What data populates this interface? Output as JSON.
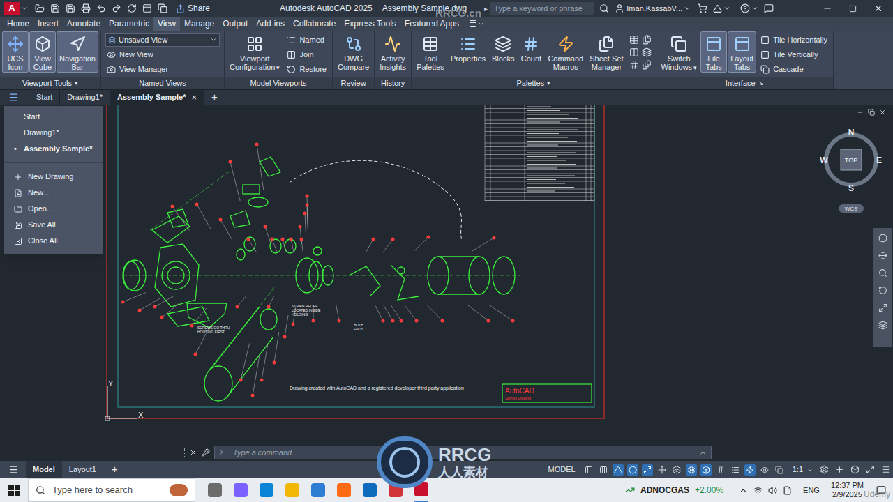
{
  "titlebar": {
    "logo": "A",
    "share": "Share",
    "app": "Autodesk AutoCAD 2025",
    "document": "Assembly Sample.dwg",
    "search_arrow": "▸",
    "search_placeholder": "Type a keyword or phrase",
    "user": "Iman.KassabV..."
  },
  "ribbon_tabs": [
    {
      "label": "Home",
      "selected": false
    },
    {
      "label": "Insert",
      "selected": false
    },
    {
      "label": "Annotate",
      "selected": false
    },
    {
      "label": "Parametric",
      "selected": false
    },
    {
      "label": "View",
      "selected": true
    },
    {
      "label": "Manage",
      "selected": false
    },
    {
      "label": "Output",
      "selected": false
    },
    {
      "label": "Add-ins",
      "selected": false
    },
    {
      "label": "Collaborate",
      "selected": false
    },
    {
      "label": "Express Tools",
      "selected": false
    },
    {
      "label": "Featured Apps",
      "selected": false
    }
  ],
  "ribbon_panels": [
    {
      "title": "Viewport Tools",
      "title_arrow": "▾",
      "large": [
        {
          "lines": [
            "UCS",
            "Icon"
          ],
          "selected": true
        },
        {
          "lines": [
            "View",
            "Cube"
          ],
          "selected": true
        },
        {
          "lines": [
            "Navigation",
            "Bar"
          ],
          "selected": true
        }
      ]
    },
    {
      "title": "Named Views",
      "dropdown": {
        "value": "Unsaved View"
      },
      "small": [
        {
          "label": "New View"
        },
        {
          "label": "View Manager"
        }
      ]
    },
    {
      "title": "Model Viewports",
      "large": [
        {
          "lines": [
            "Viewport",
            "Configuration"
          ],
          "selected": false,
          "arrow": "▾"
        }
      ],
      "small": [
        {
          "label": "Named"
        },
        {
          "label": "Join"
        },
        {
          "label": "Restore"
        }
      ]
    },
    {
      "title": "Review",
      "large": [
        {
          "lines": [
            "DWG",
            "Compare"
          ],
          "selected": false
        }
      ]
    },
    {
      "title": "History",
      "large": [
        {
          "lines": [
            "Activity",
            "Insights"
          ],
          "selected": false
        }
      ]
    },
    {
      "title": "Palettes",
      "title_arrow": "▾",
      "large": [
        {
          "lines": [
            "Tool",
            "Palettes"
          ],
          "selected": false
        },
        {
          "lines": [
            "Properties"
          ],
          "selected": false
        },
        {
          "lines": [
            "Blocks"
          ],
          "selected": false
        },
        {
          "lines": [
            "Count"
          ],
          "selected": false
        },
        {
          "lines": [
            "Command",
            "Macros"
          ],
          "selected": false
        },
        {
          "lines": [
            "Sheet Set",
            "Manager"
          ],
          "selected": false
        }
      ],
      "icon_grid": true
    },
    {
      "title": "Interface",
      "title_arrow": "↘",
      "large": [
        {
          "lines": [
            "Switch",
            "Windows"
          ],
          "selected": false,
          "arrow": "▾"
        },
        {
          "lines": [
            "File",
            "Tabs"
          ],
          "selected": true
        },
        {
          "lines": [
            "Layout",
            "Tabs"
          ],
          "selected": true
        }
      ],
      "small": [
        {
          "label": "Tile Horizontally"
        },
        {
          "label": "Tile Vertically"
        },
        {
          "label": "Cascade"
        }
      ]
    }
  ],
  "file_tabs": {
    "tabs": [
      {
        "label": "Start",
        "selected": false
      },
      {
        "label": "Drawing1*",
        "selected": false
      },
      {
        "label": "Assembly Sample*",
        "selected": true,
        "close": "×"
      }
    ],
    "add": "+"
  },
  "file_menu": {
    "documents": [
      {
        "label": "Start",
        "selected": false
      },
      {
        "label": "Drawing1*",
        "selected": false
      },
      {
        "label": "Assembly Sample*",
        "selected": true,
        "marker": "•"
      }
    ],
    "actions": [
      {
        "label": "New Drawing"
      },
      {
        "label": "New..."
      },
      {
        "label": "Open..."
      },
      {
        "label": "Save All"
      },
      {
        "label": "Close All"
      }
    ]
  },
  "drawing": {
    "notes": [
      {
        "lines": [
          "SCREWS GO THRU",
          "HOUSING FIRST"
        ]
      },
      {
        "lines": [
          "STRAIN RELIEF",
          "LOCATED INSIDE",
          "HOUSING"
        ]
      },
      {
        "lines": [
          "BOTH",
          "ENDS"
        ]
      }
    ],
    "credit": "Drawing created with AutoCAD and a registered developer third party application",
    "title_block": {
      "brand": "AutoCAD",
      "subtitle": "Sample Drawing"
    },
    "ucs": {
      "x": "X",
      "y": "Y"
    }
  },
  "viewcube": {
    "north": "N",
    "south": "S",
    "east": "E",
    "west": "W",
    "face": "TOP",
    "ucs": "WCS"
  },
  "command_line": {
    "placeholder": "Type a command"
  },
  "status_bar": {
    "layouts": [
      {
        "label": "Model",
        "selected": true
      },
      {
        "label": "Layout1",
        "selected": false
      }
    ],
    "add": "+",
    "space": "MODEL",
    "scale": "1:1",
    "toggles": [
      {
        "on": false
      },
      {
        "on": false
      },
      {
        "on": true
      },
      {
        "on": true
      },
      {
        "on": true
      },
      {
        "on": false
      },
      {
        "on": false
      },
      {
        "on": true
      },
      {
        "on": true
      },
      {
        "on": false
      },
      {
        "on": false
      },
      {
        "on": true
      },
      {
        "on": false
      },
      {
        "on": false
      }
    ]
  },
  "taskbar": {
    "search_placeholder": "Type here to search",
    "apps": [
      {
        "color": "#6c6c6c",
        "selected": false
      },
      {
        "color": "#7b61ff",
        "selected": false
      },
      {
        "color": "#0a84d6",
        "selected": false
      },
      {
        "color": "#f2b705",
        "selected": false
      },
      {
        "color": "#2d7dd2",
        "selected": false
      },
      {
        "color": "#ff6a13",
        "selected": false
      },
      {
        "color": "#0f6cbd",
        "selected": false
      },
      {
        "color": "#d13438",
        "selected": false
      },
      {
        "color": "#c8102e",
        "selected": true
      }
    ],
    "stock": {
      "symbol": "ADNOCGAS",
      "change": "+2.00%"
    },
    "language": "ENG",
    "time": "12:37 PM",
    "date": "2/9/2025"
  },
  "watermarks": {
    "site": "RRCG.cn",
    "brand": "RRCG",
    "brand_cn": "人人素材",
    "platform": "Udemy"
  }
}
